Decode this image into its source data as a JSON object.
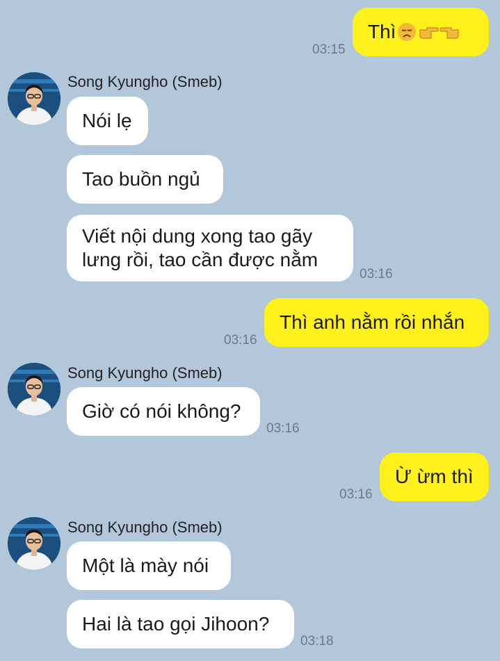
{
  "contact": {
    "name": "Song Kyungho (Smeb)",
    "avatar_icon": "profile-photo-avatar"
  },
  "messages": [
    {
      "from": "me",
      "text": "Thì",
      "emoji": [
        "disappointed-face-icon",
        "pointing-right-icon",
        "pointing-left-icon"
      ],
      "time": "03:15"
    },
    {
      "from": "them",
      "text": "Nói lẹ"
    },
    {
      "from": "them",
      "text": "Tao buồn ngủ"
    },
    {
      "from": "them",
      "text": "Viết nội dung xong tao gãy lưng rồi, tao cần được nằm",
      "time": "03:16"
    },
    {
      "from": "me",
      "text": "Thì anh nằm rồi nhắn",
      "time": "03:16"
    },
    {
      "from": "them",
      "text": "Giờ có nói không?",
      "time": "03:16"
    },
    {
      "from": "me",
      "text": "Ừ ừm thì",
      "time": "03:16"
    },
    {
      "from": "them",
      "text": "Một là mày nói"
    },
    {
      "from": "them",
      "text": "Hai là tao gọi Jihoon?",
      "time": "03:18"
    }
  ],
  "colors": {
    "background": "#b2c7d9",
    "incoming_bubble": "#ffffff",
    "outgoing_bubble": "#fef01b",
    "timestamp": "#6b7a88"
  }
}
